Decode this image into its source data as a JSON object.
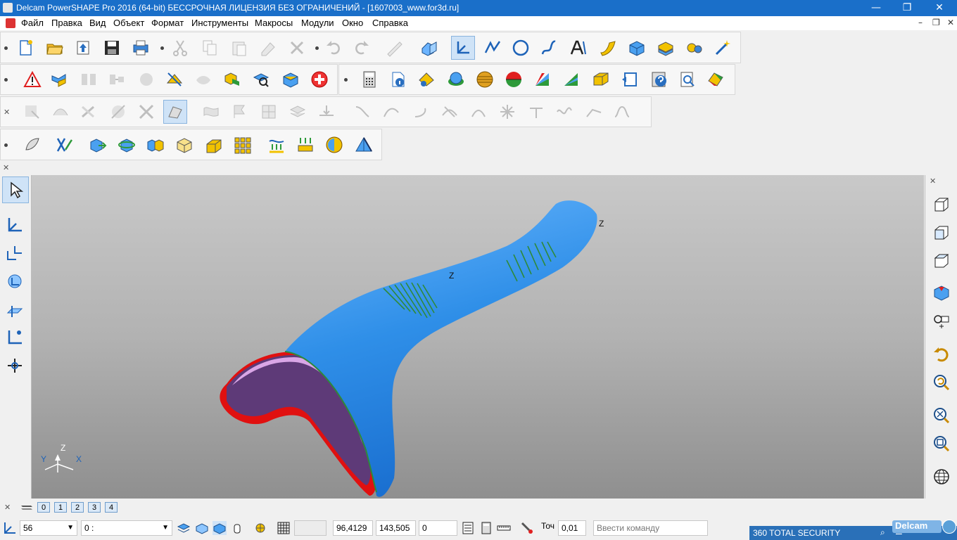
{
  "window": {
    "title": "Delcam PowerSHAPE Pro 2016 (64-bit) БЕССРОЧНАЯ ЛИЦЕНЗИЯ БЕЗ ОГРАНИЧЕНИЙ - [1607003_www.for3d.ru]",
    "minimize": "—",
    "maximize": "❐",
    "close": "✕"
  },
  "menu": {
    "items": [
      "Файл",
      "Правка",
      "Вид",
      "Объект",
      "Формат",
      "Инструменты",
      "Макросы",
      "Модули",
      "Окно",
      "Справка"
    ],
    "doc_min": "–",
    "doc_restore": "❐",
    "doc_close": "✕"
  },
  "toolbar_close": "✕",
  "viewport": {
    "axis_labels": {
      "z": "Z",
      "y": "Y",
      "x": "X"
    },
    "model_labels": {
      "z1": "Z",
      "z2": "Z",
      "z3": "Z"
    }
  },
  "tabs": {
    "close": "✕",
    "levels": [
      "0",
      "1",
      "2",
      "3",
      "4"
    ]
  },
  "status": {
    "level_value": "56",
    "set_value": "0 :",
    "coord_x": "96,4129",
    "coord_y": "143,505",
    "coord_z": "0",
    "tolerance_label": "Точ",
    "tolerance_value": "0,01",
    "command_placeholder": "Ввести команду"
  },
  "security": {
    "label": "360 TOTAL SECURITY",
    "brand_fragment": "Delcam"
  },
  "colors": {
    "titlebar": "#1a6fc9",
    "model_blue": "#2f8fe8",
    "model_purple": "#5e3a78",
    "model_red": "#e01010",
    "model_pink": "#d9a6e6",
    "hatch_green": "#2e8a3a"
  }
}
